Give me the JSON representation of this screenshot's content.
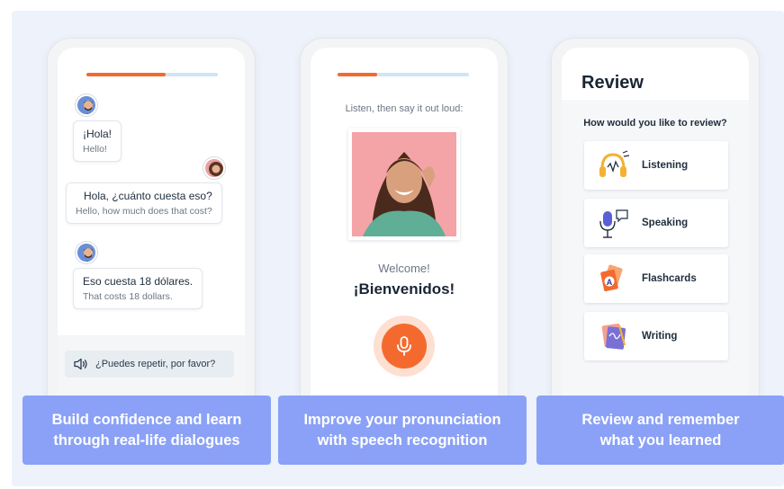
{
  "colors": {
    "accent": "#f46a2e",
    "caption_bg": "#8aa1f7",
    "progress_track": "#cfe5f4"
  },
  "dialogue": {
    "progress": 0.6,
    "messages": [
      {
        "main": "¡Hola!",
        "translation": "Hello!",
        "side": "left"
      },
      {
        "main": "Hola, ¿cuánto cuesta eso?",
        "translation": "Hello, how much does that cost?",
        "side": "right"
      },
      {
        "main": "Eso cuesta 18 dólares.",
        "translation": "That costs 18 dollars.",
        "side": "left"
      }
    ],
    "reply_icon": "speaker-icon",
    "reply_text": "¿Puedes repetir, por favor?",
    "caption": [
      "Build confidence and learn",
      "through real-life dialogues"
    ]
  },
  "pronunciation": {
    "progress": 0.3,
    "instruction": "Listen, then say it out loud:",
    "welcome": "Welcome!",
    "phrase": "¡Bienvenidos!",
    "mic_icon": "microphone-icon",
    "caption": [
      "Improve your pronunciation",
      "with speech recognition"
    ]
  },
  "review": {
    "title": "Review",
    "question": "How would you like to review?",
    "options": [
      {
        "label": "Listening",
        "icon": "headphones-icon"
      },
      {
        "label": "Speaking",
        "icon": "podcast-microphone-icon"
      },
      {
        "label": "Flashcards",
        "icon": "flashcards-icon"
      },
      {
        "label": "Writing",
        "icon": "notebook-pen-icon"
      }
    ],
    "caption": [
      "Review and remember",
      "what you learned"
    ]
  }
}
